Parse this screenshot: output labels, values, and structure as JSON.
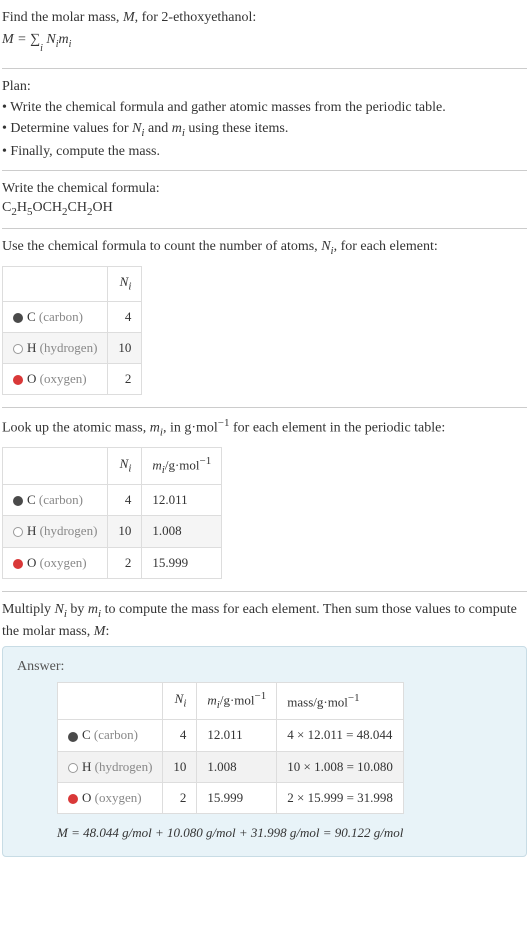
{
  "intro": {
    "line1_a": "Find the molar mass, ",
    "line1_m": "M",
    "line1_b": ", for 2-ethoxyethanol:",
    "formula": "M = ∑",
    "formula_sub": "i",
    "formula_tail": " N",
    "formula_i1": "i",
    "formula_mid": "m",
    "formula_i2": "i"
  },
  "plan": {
    "title": "Plan:",
    "items": [
      "• Write the chemical formula and gather atomic masses from the periodic table.",
      "• Determine values for Nᵢ and mᵢ using these items.",
      "• Finally, compute the mass."
    ],
    "item2_a": "• Determine values for ",
    "item2_N": "N",
    "item2_i1": "i",
    "item2_mid": " and ",
    "item2_m": "m",
    "item2_i2": "i",
    "item2_b": " using these items."
  },
  "chem_section": {
    "title": "Write the chemical formula:",
    "formula_parts": [
      "C",
      "2",
      "H",
      "5",
      "OCH",
      "2",
      "CH",
      "2",
      "OH"
    ]
  },
  "count_section": {
    "intro_a": "Use the chemical formula to count the number of atoms, ",
    "intro_N": "N",
    "intro_i": "i",
    "intro_b": ", for each element:",
    "header_N": "N",
    "header_i": "i",
    "rows": [
      {
        "swatch": "sw-c",
        "sym": "C",
        "name": "(carbon)",
        "n": "4"
      },
      {
        "swatch": "sw-h",
        "sym": "H",
        "name": "(hydrogen)",
        "n": "10"
      },
      {
        "swatch": "sw-o",
        "sym": "O",
        "name": "(oxygen)",
        "n": "2"
      }
    ]
  },
  "mass_section": {
    "intro_a": "Look up the atomic mass, ",
    "intro_m": "m",
    "intro_i": "i",
    "intro_b": ", in g·mol",
    "intro_exp": "−1",
    "intro_c": " for each element in the periodic table:",
    "h_N": "N",
    "h_Ni": "i",
    "h_m": "m",
    "h_mi": "i",
    "h_unit": "/g·mol",
    "h_exp": "−1",
    "rows": [
      {
        "swatch": "sw-c",
        "sym": "C",
        "name": "(carbon)",
        "n": "4",
        "m": "12.011"
      },
      {
        "swatch": "sw-h",
        "sym": "H",
        "name": "(hydrogen)",
        "n": "10",
        "m": "1.008"
      },
      {
        "swatch": "sw-o",
        "sym": "O",
        "name": "(oxygen)",
        "n": "2",
        "m": "15.999"
      }
    ]
  },
  "multiply_section": {
    "text_a": "Multiply ",
    "N": "N",
    "Ni": "i",
    "text_b": " by ",
    "m": "m",
    "mi": "i",
    "text_c": " to compute the mass for each element. Then sum those values to compute the molar mass, ",
    "M": "M",
    "text_d": ":"
  },
  "answer": {
    "title": "Answer:",
    "h_N": "N",
    "h_Ni": "i",
    "h_m": "m",
    "h_mi": "i",
    "h_unit": "/g·mol",
    "h_exp": "−1",
    "h_mass": "mass/g·mol",
    "h_mexp": "−1",
    "rows": [
      {
        "swatch": "sw-c",
        "sym": "C",
        "name": "(carbon)",
        "n": "4",
        "m": "12.011",
        "calc": "4 × 12.011 = 48.044"
      },
      {
        "swatch": "sw-h",
        "sym": "H",
        "name": "(hydrogen)",
        "n": "10",
        "m": "1.008",
        "calc": "10 × 1.008 = 10.080"
      },
      {
        "swatch": "sw-o",
        "sym": "O",
        "name": "(oxygen)",
        "n": "2",
        "m": "15.999",
        "calc": "2 × 15.999 = 31.998"
      }
    ],
    "final_M": "M",
    "final_eq": " = 48.044 g/mol + 10.080 g/mol + 31.998 g/mol = 90.122 g/mol"
  },
  "chart_data": {
    "type": "table",
    "title": "Molar mass of 2-ethoxyethanol",
    "elements": [
      {
        "element": "C (carbon)",
        "N_i": 4,
        "m_i_g_per_mol": 12.011,
        "mass_g_per_mol": 48.044
      },
      {
        "element": "H (hydrogen)",
        "N_i": 10,
        "m_i_g_per_mol": 1.008,
        "mass_g_per_mol": 10.08
      },
      {
        "element": "O (oxygen)",
        "N_i": 2,
        "m_i_g_per_mol": 15.999,
        "mass_g_per_mol": 31.998
      }
    ],
    "molar_mass_total_g_per_mol": 90.122
  }
}
